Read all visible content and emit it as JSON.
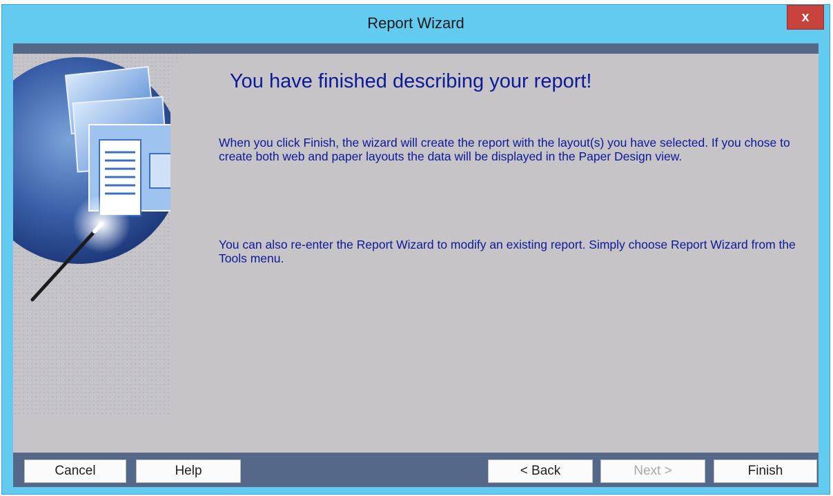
{
  "window": {
    "title": "Report Wizard",
    "close_label": "x"
  },
  "content": {
    "heading": "You have finished describing your report!",
    "paragraph1": "When you click Finish, the wizard will create the report with the layout(s) you have selected. If you chose to create both web and paper layouts the data will be displayed in the Paper Design view.",
    "paragraph2": "You can also re-enter the Report Wizard to modify an existing report. Simply choose Report Wizard from the Tools menu."
  },
  "buttons": {
    "cancel": "Cancel",
    "help": "Help",
    "back": "< Back",
    "next": "Next >",
    "finish": "Finish"
  },
  "colors": {
    "titlebar": "#62cbef",
    "close_button": "#c7423c",
    "panel": "#c6c4c6",
    "strip": "#56688a",
    "text_blue": "#0c1a9a"
  }
}
